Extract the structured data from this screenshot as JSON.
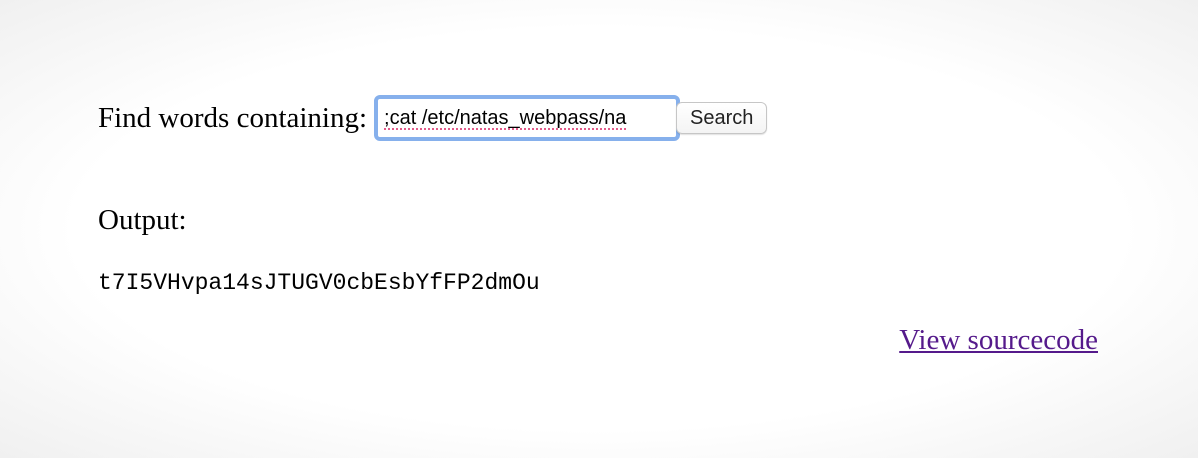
{
  "search": {
    "label": "Find words containing:",
    "value": ";cat /etc/natas_webpass/na",
    "button_label": "Search"
  },
  "output": {
    "heading": "Output:",
    "text": "t7I5VHvpa14sJTUGV0cbEsbYfFP2dmOu"
  },
  "footer": {
    "link_label": "View sourcecode"
  },
  "colors": {
    "focus_ring": "#86b0ec",
    "visited_link": "#551a8b"
  }
}
